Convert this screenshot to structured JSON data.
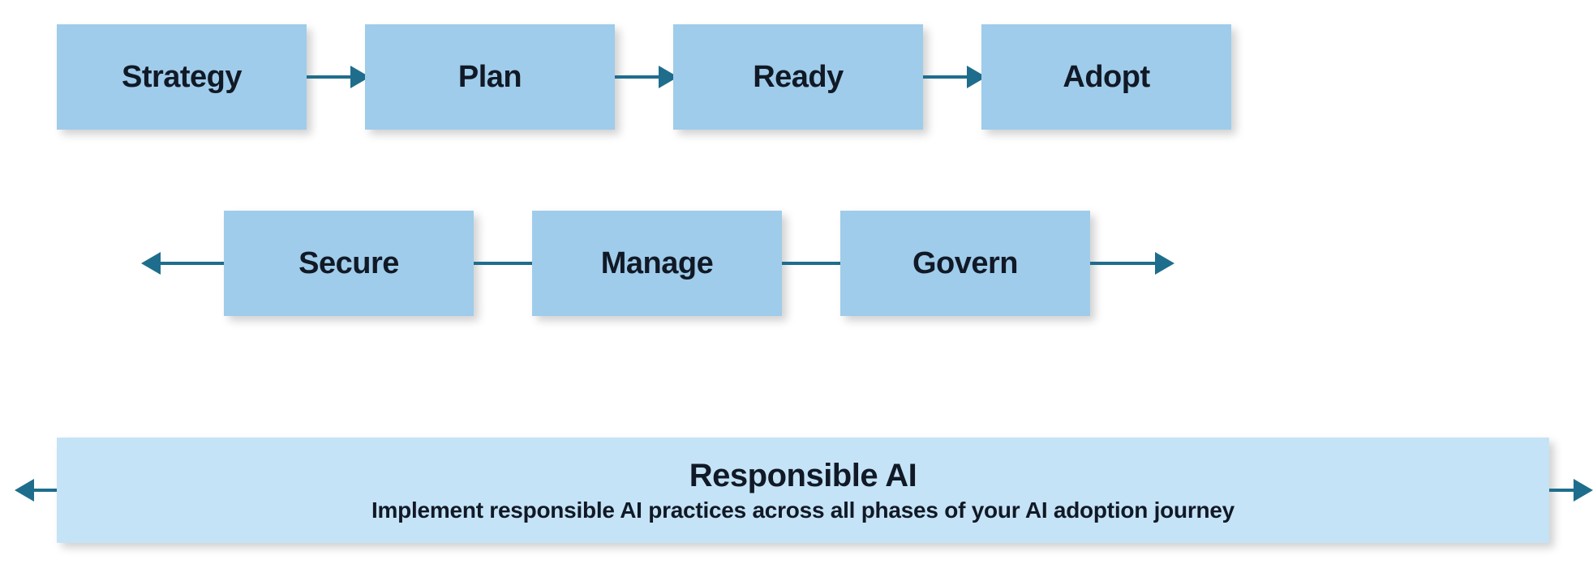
{
  "row1": {
    "strategy": "Strategy",
    "plan": "Plan",
    "ready": "Ready",
    "adopt": "Adopt"
  },
  "row2": {
    "secure": "Secure",
    "manage": "Manage",
    "govern": "Govern"
  },
  "rai": {
    "title": "Responsible AI",
    "subtitle": "Implement responsible AI practices across all phases of your AI adoption journey"
  },
  "colors": {
    "box": "#9fccea",
    "box2": "#c5e3f6",
    "arrow": "#1f6d8c",
    "text": "#111926"
  }
}
